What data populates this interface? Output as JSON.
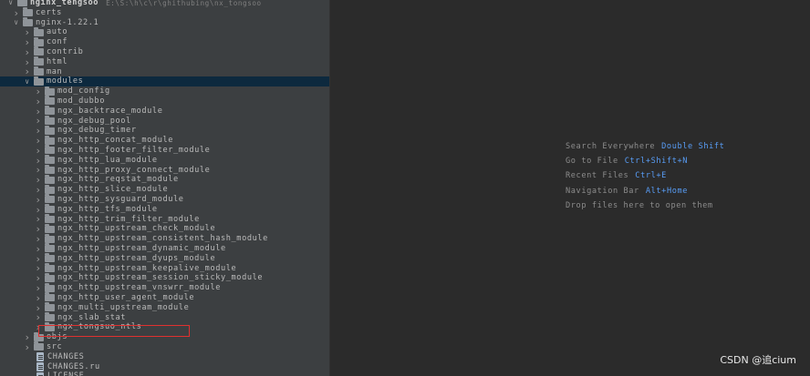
{
  "tree": {
    "root": {
      "label": "nginx_tengsoo",
      "path": "E:\\S:\\h\\c\\r\\ghithubing\\nx_tongsoo"
    },
    "top_items": [
      {
        "label": "certs",
        "kind": "folder",
        "expanded": false
      },
      {
        "label": "nginx-1.22.1",
        "kind": "folder",
        "expanded": true
      }
    ],
    "nginx_children": [
      {
        "label": "auto",
        "kind": "folder",
        "expanded": false
      },
      {
        "label": "conf",
        "kind": "folder",
        "expanded": false
      },
      {
        "label": "contrib",
        "kind": "folder",
        "expanded": false
      },
      {
        "label": "html",
        "kind": "folder",
        "expanded": false
      },
      {
        "label": "man",
        "kind": "folder",
        "expanded": false
      },
      {
        "label": "modules",
        "kind": "folder",
        "expanded": true,
        "selected": true
      }
    ],
    "modules_children": [
      "mod_config",
      "mod_dubbo",
      "ngx_backtrace_module",
      "ngx_debug_pool",
      "ngx_debug_timer",
      "ngx_http_concat_module",
      "ngx_http_footer_filter_module",
      "ngx_http_lua_module",
      "ngx_http_proxy_connect_module",
      "ngx_http_reqstat_module",
      "ngx_http_slice_module",
      "ngx_http_sysguard_module",
      "ngx_http_tfs_module",
      "ngx_http_trim_filter_module",
      "ngx_http_upstream_check_module",
      "ngx_http_upstream_consistent_hash_module",
      "ngx_http_upstream_dynamic_module",
      "ngx_http_upstream_dyups_module",
      "ngx_http_upstream_keepalive_module",
      "ngx_http_upstream_session_sticky_module",
      "ngx_http_upstream_vnswrr_module",
      "ngx_http_user_agent_module",
      "ngx_multi_upstream_module",
      "ngx_slab_stat",
      "ngx_tongsuo_ntls"
    ],
    "after_modules": [
      {
        "label": "objs",
        "kind": "folder",
        "indent": 1
      },
      {
        "label": "src",
        "kind": "folder",
        "indent": 1
      },
      {
        "label": "CHANGES",
        "kind": "file",
        "indent": 1
      },
      {
        "label": "CHANGES.ru",
        "kind": "file",
        "indent": 1
      },
      {
        "label": "LICENSE",
        "kind": "file",
        "indent": 1
      }
    ]
  },
  "editor": {
    "hints": [
      {
        "text": "Search Everywhere",
        "key": "Double Shift"
      },
      {
        "text": "Go to File",
        "key": "Ctrl+Shift+N"
      },
      {
        "text": "Recent Files",
        "key": "Ctrl+E"
      },
      {
        "text": "Navigation Bar",
        "key": "Alt+Home"
      },
      {
        "text": "Drop files here to open them",
        "key": ""
      }
    ]
  },
  "watermark": "CSDN @追cium",
  "colors": {
    "tree_bg": "#3c3f41",
    "editor_bg": "#2b2b2b",
    "selection": "#0d293e",
    "shortcut": "#589df6",
    "highlight_box": "#e0312f"
  }
}
